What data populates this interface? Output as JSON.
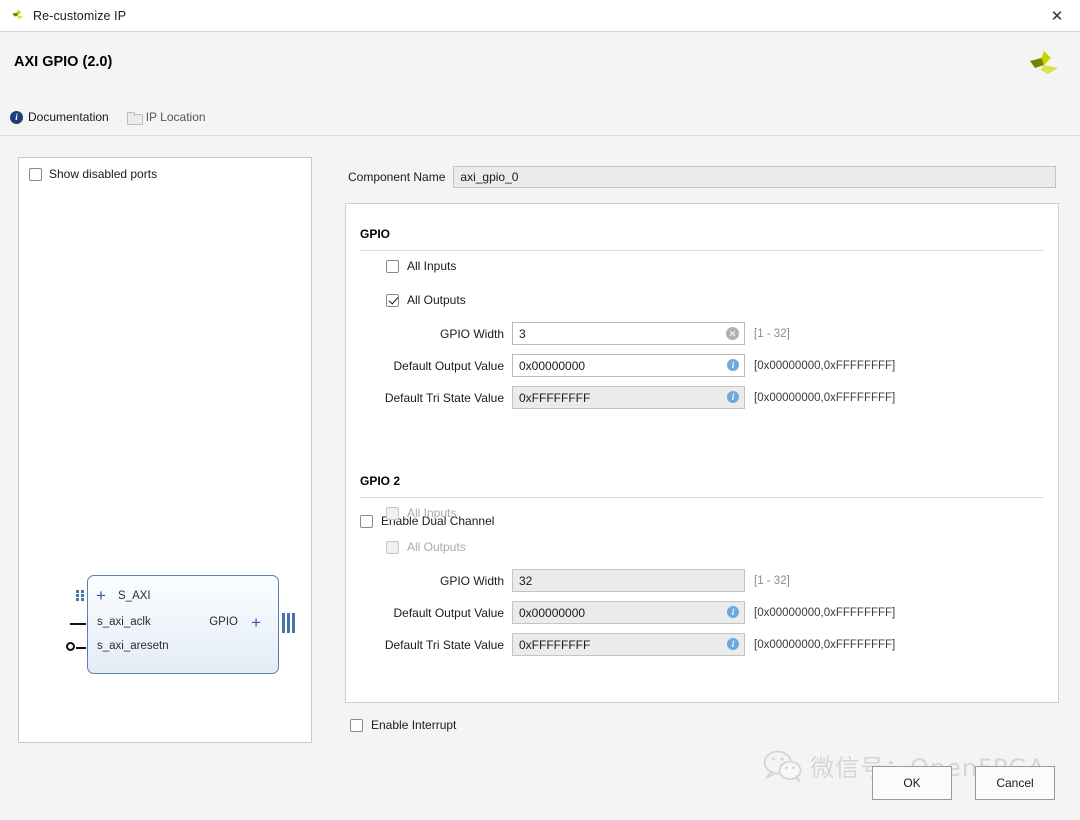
{
  "window": {
    "title": "Re-customize IP",
    "close_label": "✕",
    "app_icon": "xilinx-logo-icon"
  },
  "header": {
    "title": "AXI GPIO (2.0)",
    "logo": "xilinx-logo-icon",
    "links": [
      {
        "label": "Documentation",
        "icon": "info-icon",
        "enabled": true
      },
      {
        "label": "IP Location",
        "icon": "folder-icon",
        "enabled": false
      }
    ]
  },
  "ports_panel": {
    "show_disabled_ports": {
      "label": "Show disabled ports",
      "checked": false
    },
    "block": {
      "bus_port": "S_AXI",
      "input_ports": [
        "s_axi_aclk",
        "s_axi_aresetn"
      ],
      "output_port": "GPIO",
      "expand_icon": "plus-icon"
    }
  },
  "component": {
    "label": "Component Name",
    "value": "axi_gpio_0"
  },
  "gpio": {
    "title": "GPIO",
    "all_inputs": {
      "label": "All Inputs",
      "checked": false,
      "enabled": true
    },
    "all_outputs": {
      "label": "All Outputs",
      "checked": true,
      "enabled": true
    },
    "width": {
      "label": "GPIO Width",
      "value": "3",
      "hint": "[1 - 32]",
      "icon": "clear-icon",
      "readonly": false
    },
    "default_output": {
      "label": "Default Output Value",
      "value": "0x00000000",
      "hint": "[0x00000000,0xFFFFFFFF]",
      "icon": "info-icon",
      "readonly": false
    },
    "default_tristate": {
      "label": "Default Tri State Value",
      "value": "0xFFFFFFFF",
      "hint": "[0x00000000,0xFFFFFFFF]",
      "icon": "info-icon",
      "readonly": true
    }
  },
  "dual_channel": {
    "label": "Enable Dual Channel",
    "checked": false
  },
  "gpio2": {
    "title": "GPIO 2",
    "all_inputs": {
      "label": "All Inputs",
      "checked": false,
      "enabled": false
    },
    "all_outputs": {
      "label": "All Outputs",
      "checked": false,
      "enabled": false
    },
    "width": {
      "label": "GPIO Width",
      "value": "32",
      "hint": "[1 - 32]",
      "icon": "none",
      "readonly": true
    },
    "default_output": {
      "label": "Default Output Value",
      "value": "0x00000000",
      "hint": "[0x00000000,0xFFFFFFFF]",
      "icon": "info-icon",
      "readonly": true
    },
    "default_tristate": {
      "label": "Default Tri State Value",
      "value": "0xFFFFFFFF",
      "hint": "[0x00000000,0xFFFFFFFF]",
      "icon": "info-icon",
      "readonly": true
    }
  },
  "interrupt": {
    "label": "Enable Interrupt",
    "checked": false
  },
  "buttons": {
    "ok": "OK",
    "cancel": "Cancel"
  },
  "watermark": {
    "text": "微信号：OpenFPGA",
    "logo": "wechat-icon"
  },
  "colors": {
    "dialog_bg": "#f4f4f4",
    "panel_bg": "#ffffff",
    "accent_blue": "#2f5c9e",
    "info_blue": "#6fa8dc",
    "logo_green": "#c8d400",
    "logo_olive": "#7a8000"
  }
}
